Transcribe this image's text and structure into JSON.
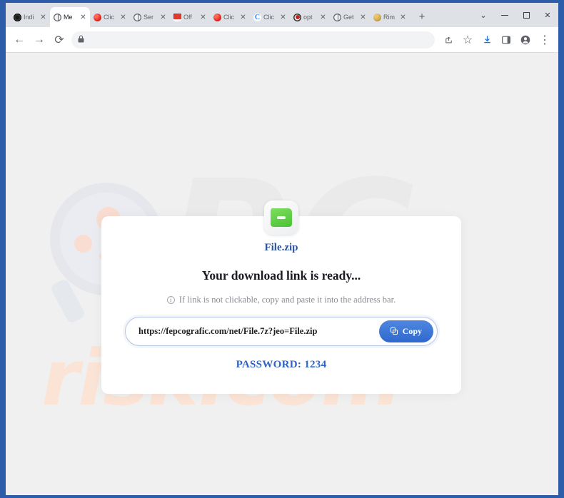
{
  "browser": {
    "tabs": [
      {
        "label": "Indi",
        "favicon": "film-reel-icon",
        "active": false
      },
      {
        "label": "Me",
        "favicon": "globe-icon",
        "active": true
      },
      {
        "label": "Clic",
        "favicon": "red-dot-icon",
        "active": false
      },
      {
        "label": "Ser",
        "favicon": "globe-icon",
        "active": false
      },
      {
        "label": "Off",
        "favicon": "red-square-icon",
        "active": false
      },
      {
        "label": "Clic",
        "favicon": "red-dot-icon",
        "active": false
      },
      {
        "label": "Clic",
        "favicon": "c-letter-icon",
        "active": false
      },
      {
        "label": "opt",
        "favicon": "target-ring-icon",
        "active": false
      },
      {
        "label": "Get",
        "favicon": "globe-icon",
        "active": false
      },
      {
        "label": "Rim",
        "favicon": "gold-coin-icon",
        "active": false
      }
    ],
    "new_tab_label": "+",
    "tab_close_label": "✕",
    "tab_list_chevron": "⌄",
    "window_controls": {
      "minimize": "–",
      "maximize": "□",
      "close": "✕"
    },
    "toolbar": {
      "back": "←",
      "forward": "→",
      "reload": "⟳",
      "lock_icon": "🔒",
      "address_value": "",
      "address_placeholder": "",
      "share_icon": "➦",
      "bookmark_icon": "☆",
      "download_icon": "⬇",
      "sidepanel_icon": "▧",
      "profile_icon": "●",
      "menu_icon": "⋮"
    }
  },
  "page": {
    "watermark_pc": "PC",
    "watermark_risk": "risk.com",
    "card": {
      "file_icon_name": "green-zip-folder-icon",
      "filename": "File.zip",
      "headline": "Your download link is ready...",
      "hint_icon": "i",
      "hint": "If link is not clickable, copy and paste it into the address bar.",
      "link_url": "https://fepcografic.com/net/File.7z?jeo=File.zip",
      "copy_button_label": "Copy",
      "password": "PASSWORD: 1234"
    }
  },
  "colors": {
    "window_frame": "#2d5ca8",
    "accent_blue": "#2f68cf",
    "filename_blue": "#2f53a0",
    "password_blue": "#2f63c4",
    "zip_green": "#49c234",
    "watermark_peach": "#fbe4d6",
    "page_bg": "#f0f0f0"
  }
}
